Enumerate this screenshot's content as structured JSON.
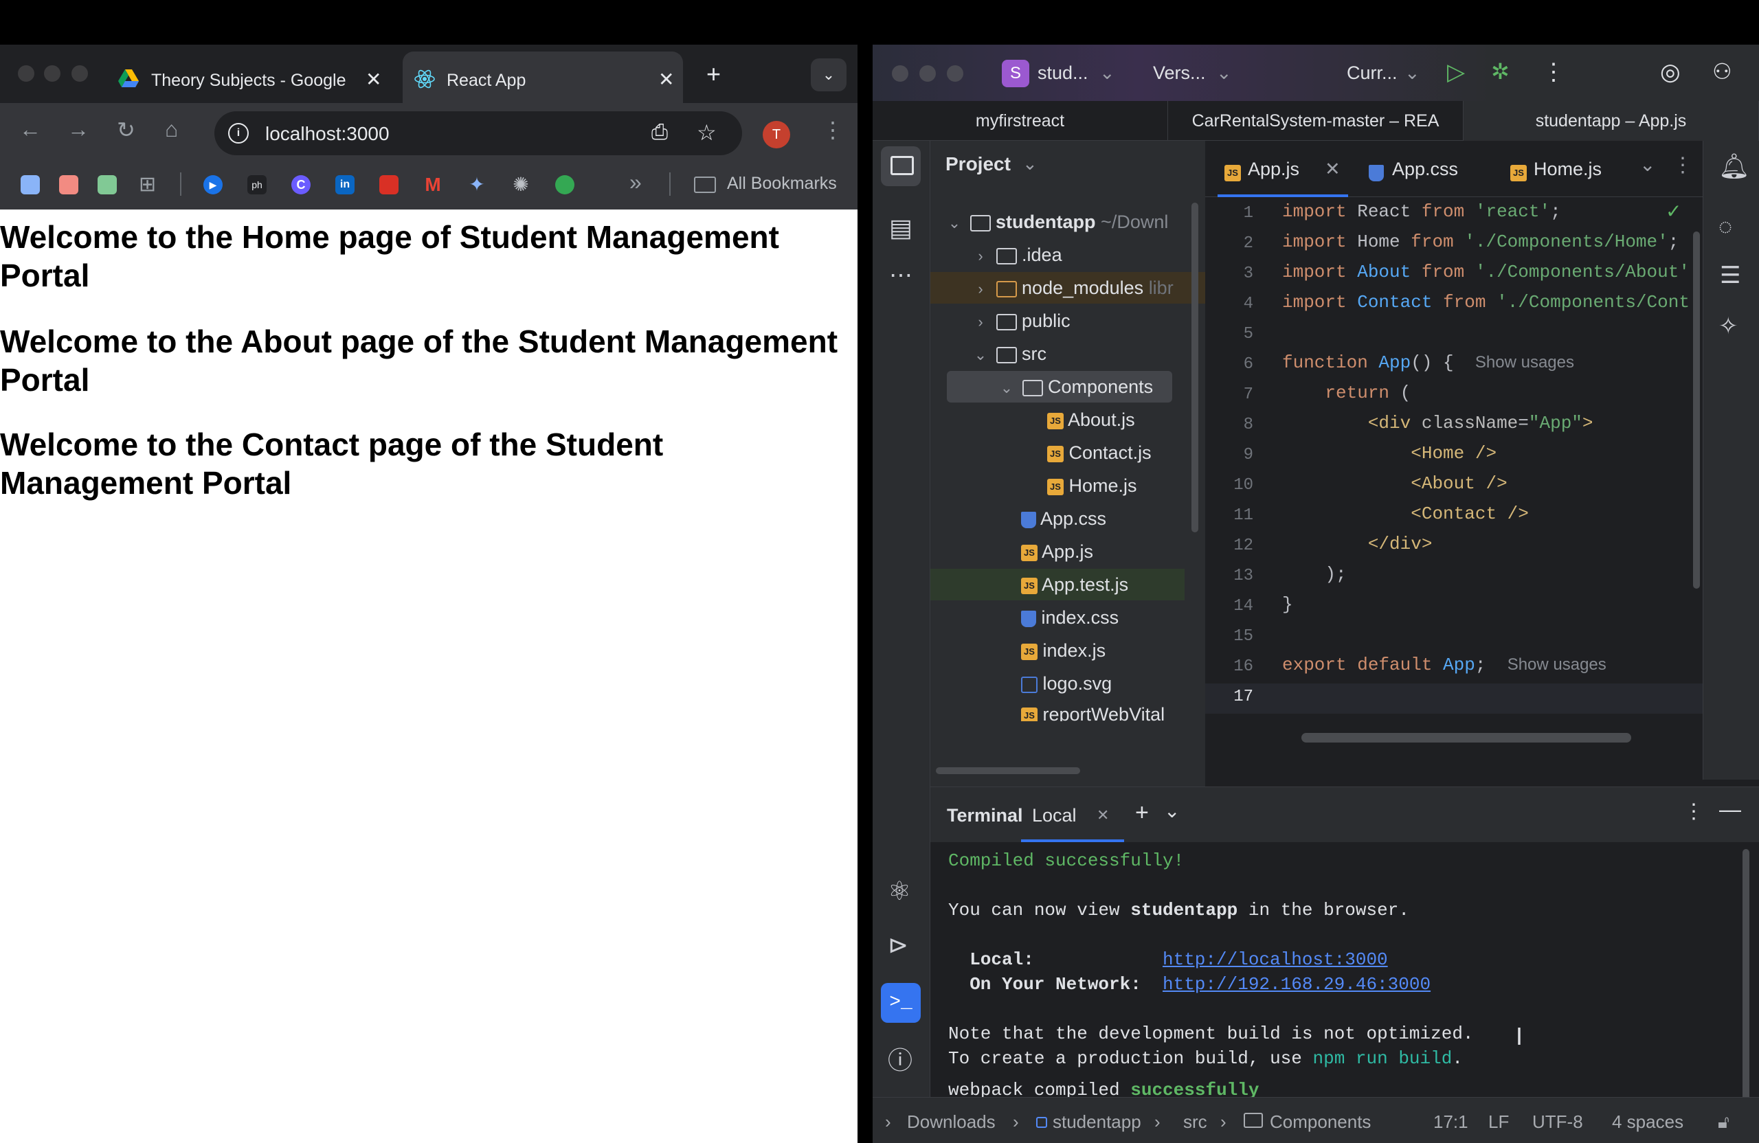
{
  "browser": {
    "tabs": [
      {
        "title": "Theory Subjects - Google",
        "icon": "google-drive-icon"
      },
      {
        "title": "React App",
        "icon": "react-icon"
      }
    ],
    "new_tab": "+",
    "url": "localhost:3000",
    "profile_initial": "T",
    "all_bookmarks": "All Bookmarks",
    "bookmarks_overflow": "»",
    "bookmark_labels": [
      "ph"
    ],
    "page_headings": [
      "Welcome to the Home page of Student Management Portal",
      "Welcome to the About page of the Student Management Portal",
      "Welcome to the Contact page of the Student Management Portal"
    ]
  },
  "ide": {
    "header": {
      "project_badge": "S",
      "project_name": "stud...",
      "vcs": "Vers...",
      "run_config": "Curr..."
    },
    "project_tabs": [
      "myfirstreact",
      "CarRentalSystem-master – REA",
      "studentapp – App.js"
    ],
    "project_panel": {
      "title": "Project",
      "tree": [
        {
          "label": "studentapp",
          "suffix": "~/Downl",
          "type": "root"
        },
        {
          "label": ".idea",
          "type": "folder"
        },
        {
          "label": "node_modules",
          "suffix": "libr",
          "type": "folder"
        },
        {
          "label": "public",
          "type": "folder"
        },
        {
          "label": "src",
          "type": "folder"
        },
        {
          "label": "Components",
          "type": "folder"
        },
        {
          "label": "About.js",
          "type": "js"
        },
        {
          "label": "Contact.js",
          "type": "js"
        },
        {
          "label": "Home.js",
          "type": "js"
        },
        {
          "label": "App.css",
          "type": "css"
        },
        {
          "label": "App.js",
          "type": "js"
        },
        {
          "label": "App.test.js",
          "type": "js"
        },
        {
          "label": "index.css",
          "type": "css"
        },
        {
          "label": "index.js",
          "type": "js"
        },
        {
          "label": "logo.svg",
          "type": "svg"
        },
        {
          "label": "reportWebVital",
          "type": "js"
        }
      ]
    },
    "editor_tabs": [
      "App.js",
      "App.css",
      "Home.js"
    ],
    "editor_js_badge": "JS",
    "line_numbers": [
      "1",
      "2",
      "3",
      "4",
      "5",
      "6",
      "7",
      "8",
      "9",
      "10",
      "11",
      "12",
      "13",
      "14",
      "15",
      "16",
      "17"
    ],
    "code": {
      "l1": [
        "import",
        " React ",
        "from",
        " 'react'",
        ";"
      ],
      "l2": [
        "import",
        " Home ",
        "from",
        " './Components/Home'",
        ";"
      ],
      "l3": [
        "import",
        " About ",
        "from",
        " './Components/About'"
      ],
      "l4": [
        "import",
        " Contact ",
        "from",
        " './Components/Cont"
      ],
      "l6": [
        "function",
        " App",
        "() {",
        "Show usages"
      ],
      "l7": [
        "return",
        " ("
      ],
      "l8": [
        "<div",
        " className",
        "=",
        "\"App\"",
        ">"
      ],
      "l9": [
        "<Home",
        " />"
      ],
      "l10": [
        "<About",
        " />"
      ],
      "l11": [
        "<Contact",
        " />"
      ],
      "l12": [
        "</div>"
      ],
      "l13": [
        ");"
      ],
      "l14": [
        "}"
      ],
      "l16": [
        "export default",
        " App",
        ";",
        "Show usages"
      ]
    },
    "terminal": {
      "title": "Terminal",
      "tab": "Local",
      "line1": "Compiled successfully!",
      "line2_pre": "You can now view ",
      "line2_app": "studentapp",
      "line2_post": " in the browser.",
      "local_label": "  Local:",
      "local_url": "http://localhost:3000",
      "network_label": "  On Your Network:",
      "network_url": "http://192.168.29.46:3000",
      "note1": "Note that the development build is not optimized.",
      "note2_pre": "To create a production build, use ",
      "note2_cmd": "npm run build",
      "note2_post": ".",
      "webpack_pre": "webpack compiled ",
      "webpack_ok": "successfully"
    },
    "statusbar": {
      "crumbs": [
        "Downloads",
        "studentapp",
        "src",
        "Components"
      ],
      "position": "17:1",
      "line_ending": "LF",
      "encoding": "UTF-8",
      "indent": "4 spaces"
    }
  }
}
